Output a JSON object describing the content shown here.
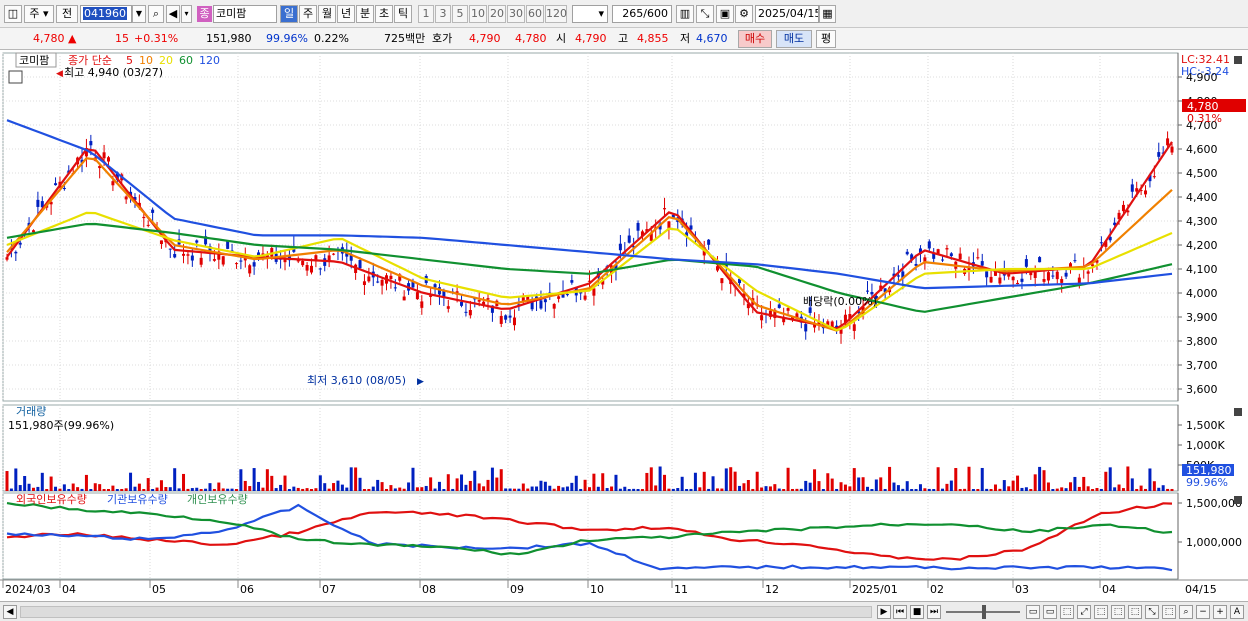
{
  "toolbar": {
    "period_sel": "주",
    "prev_label": "전",
    "code": "041960",
    "stock_name": "코미팜",
    "name_tag": "종",
    "periods": [
      "일",
      "주",
      "월",
      "년",
      "분",
      "초",
      "틱"
    ],
    "active_period": "일",
    "numbers": [
      "1",
      "3",
      "5",
      "10",
      "20",
      "30",
      "60",
      "120"
    ],
    "count": "265",
    "count_total": "/600",
    "date": "2025/04/15"
  },
  "quote": {
    "price": "4,780",
    "arrow": "▲",
    "change": "15",
    "change_pct": "+0.31%",
    "volume": "151,980",
    "vol_ratio": "99.96%",
    "turnover": "0.22%",
    "amount": "725백만",
    "hoga_label": "호가",
    "ask": "4,790",
    "bid": "4,780",
    "open_label": "시",
    "open": "4,790",
    "high_label": "고",
    "high": "4,855",
    "low_label": "저",
    "low": "4,670",
    "buy_label": "매수",
    "sell_label": "매도",
    "even_label": "평"
  },
  "price_panel": {
    "name_label": "코미팜",
    "legend_prefix": "종가 단순",
    "legend_ma": [
      {
        "label": "5",
        "color": "#e01010"
      },
      {
        "label": "10",
        "color": "#f08000"
      },
      {
        "label": "20",
        "color": "#e8e000"
      },
      {
        "label": "60",
        "color": "#109030"
      },
      {
        "label": "120",
        "color": "#2050e0"
      }
    ],
    "high_note": "최고 4,940 (03/27)",
    "low_note": "최저 3,610 (08/05)",
    "dividend_note": "배당락(0.00%)",
    "lc": "LC:32.41",
    "hc": "HC:-3.24",
    "current_price": "4,780",
    "current_pct": "0.31%",
    "y_ticks": [
      "4,900",
      "4,800",
      "4,700",
      "4,600",
      "4,500",
      "4,400",
      "4,300",
      "4,200",
      "4,100",
      "4,000",
      "3,900",
      "3,800",
      "3,700",
      "3,600"
    ]
  },
  "volume_panel": {
    "title": "거래량",
    "value": "151,980주(99.96%)",
    "y_ticks": [
      "1,500K",
      "1,000K",
      "500K"
    ],
    "current_value": "151,980",
    "current_pct": "99.96%"
  },
  "holdings_panel": {
    "legend": [
      {
        "label": "외국인보유수량",
        "color": "#e01010"
      },
      {
        "label": "기관보유수량",
        "color": "#2050e0"
      },
      {
        "label": "개인보유수량",
        "color": "#2e9050"
      }
    ],
    "y_ticks": [
      "1,500,000",
      "1,000,000"
    ]
  },
  "x_axis": {
    "labels": [
      "2024/03",
      "04",
      "05",
      "06",
      "07",
      "08",
      "09",
      "10",
      "11",
      "12",
      "2025/01",
      "02",
      "03",
      "04"
    ],
    "right_label": "04/15"
  },
  "colors": {
    "up": "#e00000",
    "down": "#0020c0",
    "ma5": "#e01010",
    "ma10": "#f08000",
    "ma20": "#e8e000",
    "ma60": "#109030",
    "ma120": "#2050e0"
  },
  "chart_data": {
    "type": "line",
    "x": [
      "2024/03",
      "04",
      "05",
      "06",
      "07",
      "08",
      "09",
      "10",
      "11",
      "12",
      "2025/01",
      "02",
      "03",
      "04",
      "04/15"
    ],
    "series": [
      {
        "name": "5",
        "values": [
          4150,
          4620,
          4180,
          4150,
          4130,
          4000,
          3930,
          4040,
          4350,
          3920,
          3850,
          4180,
          4080,
          4110,
          4630
        ]
      },
      {
        "name": "10",
        "values": [
          4170,
          4580,
          4200,
          4140,
          4180,
          4030,
          3950,
          4020,
          4330,
          3950,
          3840,
          4130,
          4090,
          4110,
          4430
        ]
      },
      {
        "name": "20",
        "values": [
          4200,
          4340,
          4220,
          4150,
          4230,
          4060,
          3980,
          4010,
          4280,
          4010,
          3840,
          4080,
          4100,
          4100,
          4250
        ]
      },
      {
        "name": "60",
        "values": [
          4230,
          4290,
          4250,
          4200,
          4180,
          4140,
          4100,
          4080,
          4140,
          4110,
          4000,
          3920,
          3980,
          4040,
          4120
        ]
      },
      {
        "name": "120",
        "values": [
          4720,
          4590,
          4310,
          4240,
          4240,
          4230,
          4200,
          4170,
          4140,
          4120,
          4080,
          4020,
          4030,
          4040,
          4080
        ]
      }
    ],
    "ylim": [
      3550,
      5000
    ]
  }
}
